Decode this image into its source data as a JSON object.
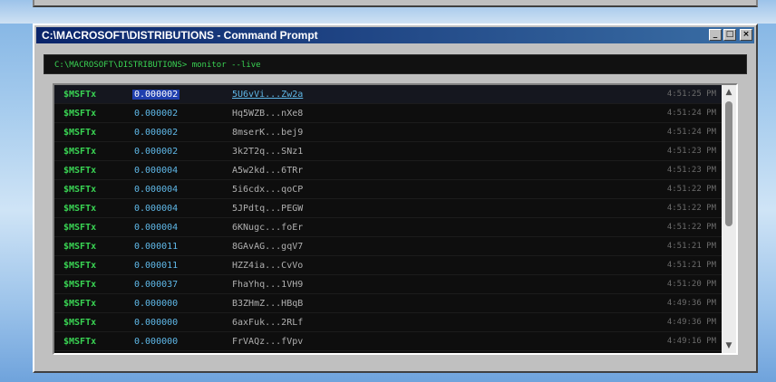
{
  "window": {
    "title": "C:\\MACROSOFT\\DISTRIBUTIONS - Command Prompt",
    "minimize_label": "_",
    "maximize_label": "□",
    "close_label": "×"
  },
  "command": {
    "text": "C:\\MACROSOFT\\DISTRIBUTIONS> monitor --live"
  },
  "rows": [
    {
      "ticker": "$MSFTx",
      "amount": "0.000002",
      "address": "5U6vVi...Zw2a",
      "time": "4:51:25 PM"
    },
    {
      "ticker": "$MSFTx",
      "amount": "0.000002",
      "address": "Hq5WZB...nXe8",
      "time": "4:51:24 PM"
    },
    {
      "ticker": "$MSFTx",
      "amount": "0.000002",
      "address": "8mserK...bej9",
      "time": "4:51:24 PM"
    },
    {
      "ticker": "$MSFTx",
      "amount": "0.000002",
      "address": "3k2T2q...SNz1",
      "time": "4:51:23 PM"
    },
    {
      "ticker": "$MSFTx",
      "amount": "0.000004",
      "address": "A5w2kd...6TRr",
      "time": "4:51:23 PM"
    },
    {
      "ticker": "$MSFTx",
      "amount": "0.000004",
      "address": "5i6cdx...qoCP",
      "time": "4:51:22 PM"
    },
    {
      "ticker": "$MSFTx",
      "amount": "0.000004",
      "address": "5JPdtq...PEGW",
      "time": "4:51:22 PM"
    },
    {
      "ticker": "$MSFTx",
      "amount": "0.000004",
      "address": "6KNugc...foEr",
      "time": "4:51:22 PM"
    },
    {
      "ticker": "$MSFTx",
      "amount": "0.000011",
      "address": "8GAvAG...gqV7",
      "time": "4:51:21 PM"
    },
    {
      "ticker": "$MSFTx",
      "amount": "0.000011",
      "address": "HZZ4ia...CvVo",
      "time": "4:51:21 PM"
    },
    {
      "ticker": "$MSFTx",
      "amount": "0.000037",
      "address": "FhaYhq...1VH9",
      "time": "4:51:20 PM"
    },
    {
      "ticker": "$MSFTx",
      "amount": "0.000000",
      "address": "B3ZHmZ...HBqB",
      "time": "4:49:36 PM"
    },
    {
      "ticker": "$MSFTx",
      "amount": "0.000000",
      "address": "6axFuk...2RLf",
      "time": "4:49:36 PM"
    },
    {
      "ticker": "$MSFTx",
      "amount": "0.000000",
      "address": "FrVAQz...fVpv",
      "time": "4:49:16 PM"
    }
  ],
  "scrollbar": {
    "up_icon": "▲",
    "down_icon": "▼"
  },
  "colors": {
    "ticker": "#39d353",
    "amount": "#5fb8e8",
    "selection": "#1f3fae",
    "title_bar": "#0a246a"
  }
}
